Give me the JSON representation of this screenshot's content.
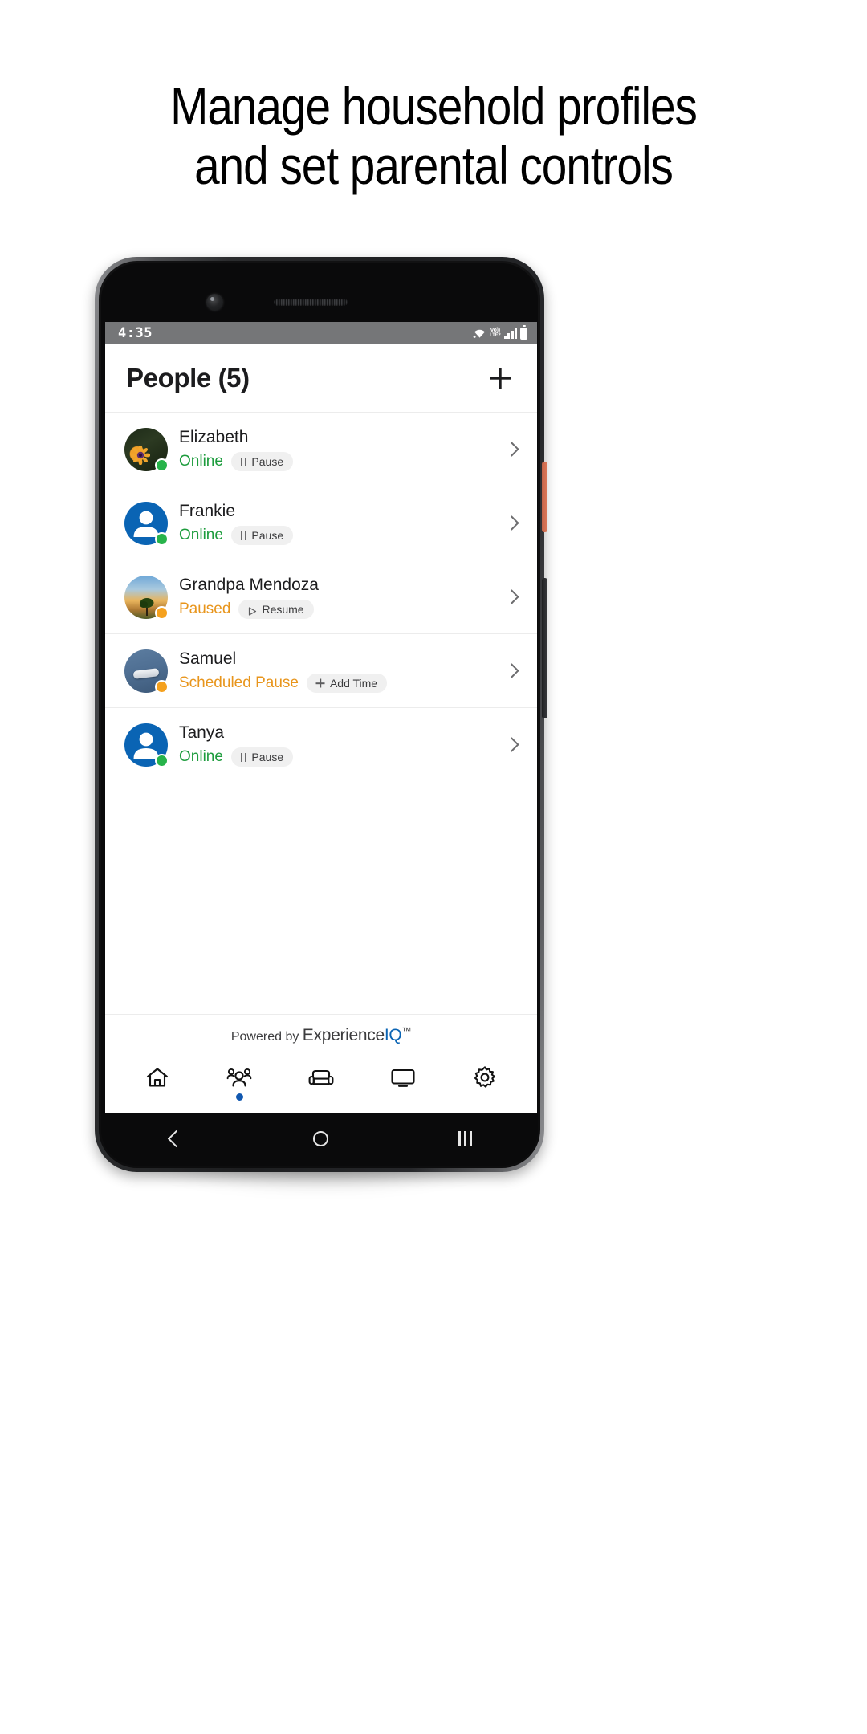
{
  "headline": {
    "line1": "Manage household profiles",
    "line2": "and set parental controls"
  },
  "phone": {
    "statusbar": {
      "time": "4:35",
      "wifi_icon": "wifi-icon",
      "volte_top": "Vo))",
      "volte_bottom": "LTE2",
      "signal_icon": "signal-bars-icon",
      "battery_icon": "battery-icon"
    },
    "header": {
      "title": "People (5)",
      "add_icon": "plus-icon"
    },
    "people": [
      {
        "name": "Elizabeth",
        "status": "Online",
        "status_type": "online",
        "action_label": "Pause",
        "action_icon": "pause-icon",
        "avatar_type": "photo-eliz",
        "avatar_icon": "avatar-photo",
        "chevron_icon": "chevron-right-icon"
      },
      {
        "name": "Frankie",
        "status": "Online",
        "status_type": "online",
        "action_label": "Pause",
        "action_icon": "pause-icon",
        "avatar_type": "default",
        "avatar_icon": "person-avatar-icon",
        "chevron_icon": "chevron-right-icon"
      },
      {
        "name": "Grandpa Mendoza",
        "status": "Paused",
        "status_type": "paused",
        "action_label": "Resume",
        "action_icon": "play-icon",
        "avatar_type": "photo-grandpa",
        "avatar_icon": "avatar-photo",
        "chevron_icon": "chevron-right-icon"
      },
      {
        "name": "Samuel",
        "status": "Scheduled Pause",
        "status_type": "paused",
        "action_label": "Add Time",
        "action_icon": "plus-icon",
        "avatar_type": "photo-samuel",
        "avatar_icon": "avatar-photo",
        "chevron_icon": "chevron-right-icon"
      },
      {
        "name": "Tanya",
        "status": "Online",
        "status_type": "online",
        "action_label": "Pause",
        "action_icon": "pause-icon",
        "avatar_type": "default",
        "avatar_icon": "person-avatar-icon",
        "chevron_icon": "chevron-right-icon"
      }
    ],
    "footer": {
      "powered_prefix": "Powered by ",
      "brand_first": "Experience",
      "brand_iq": "IQ",
      "brand_tm": "™"
    },
    "tabs": [
      {
        "name": "home",
        "icon": "home-icon",
        "active": false
      },
      {
        "name": "people",
        "icon": "people-icon",
        "active": true
      },
      {
        "name": "devices",
        "icon": "sofa-icon",
        "active": false
      },
      {
        "name": "network",
        "icon": "monitor-icon",
        "active": false
      },
      {
        "name": "settings",
        "icon": "gear-icon",
        "active": false
      }
    ],
    "navbar": {
      "back_icon": "back-icon",
      "home_icon": "home-circle-icon",
      "recents_icon": "recents-icon"
    }
  },
  "colors": {
    "online": "#1d9c3d",
    "paused": "#e8951c",
    "brand_blue": "#0a64b4",
    "tab_active": "#1158b0",
    "statusbar_bg": "#757678"
  }
}
